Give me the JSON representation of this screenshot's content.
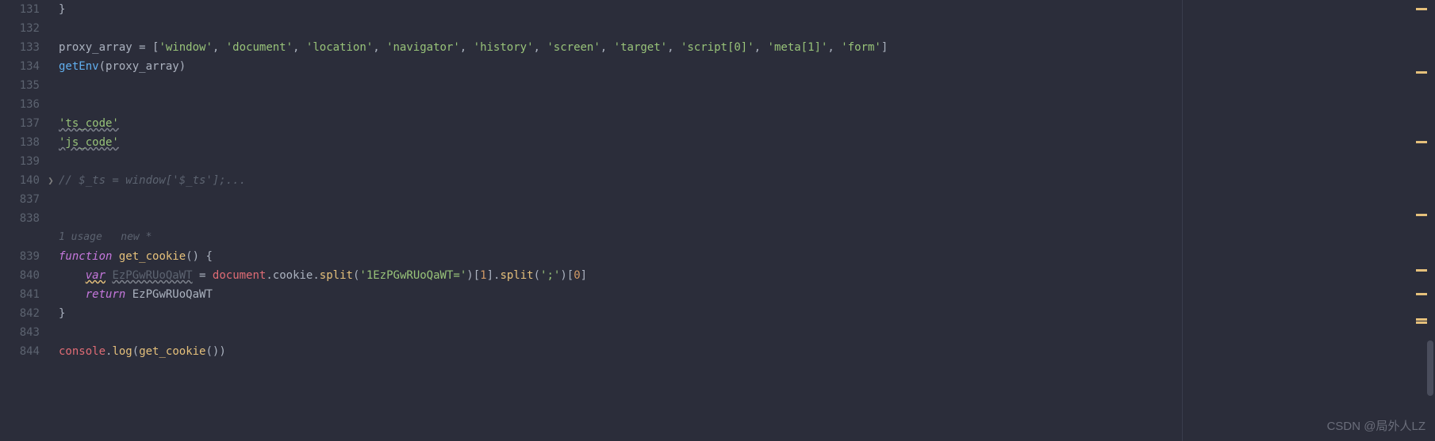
{
  "gutter": {
    "lines": [
      "131",
      "132",
      "133",
      "134",
      "135",
      "136",
      "137",
      "138",
      "139",
      "140",
      "837",
      "838",
      "",
      "839",
      "840",
      "841",
      "842",
      "843",
      "844"
    ]
  },
  "fold": {
    "marker_index": 9,
    "marker_glyph": "❯"
  },
  "code": {
    "l131": "}",
    "l133_var": "proxy_array",
    "l133_eq": " = ",
    "l133_open": "[",
    "l133_s1": "'window'",
    "l133_s2": "'document'",
    "l133_s3": "'location'",
    "l133_s4": "'navigator'",
    "l133_s5": "'history'",
    "l133_s6": "'screen'",
    "l133_s7": "'target'",
    "l133_s8": "'script[0]'",
    "l133_s9": "'meta[1]'",
    "l133_s10": "'form'",
    "l133_comma": ", ",
    "l133_close": "]",
    "l134_fn": "getEnv",
    "l134_open": "(",
    "l134_arg": "proxy_array",
    "l134_close": ")",
    "l137": "'ts_code'",
    "l138": "'js_code'",
    "l140": "// $_ts = window['$_ts'];...",
    "inlay": "1 usage   new *",
    "l839_kw": "function",
    "l839_sp": " ",
    "l839_name": "get_cookie",
    "l839_tail": "() {",
    "l840_indent": "    ",
    "l840_var": "var",
    "l840_sp": " ",
    "l840_id": "EzPGwRUoQaWT",
    "l840_eq": " = ",
    "l840_doc": "document",
    "l840_dot": ".",
    "l840_cookie": "cookie",
    "l840_split1": "split",
    "l840_arg1": "'1EzPGwRUoQaWT='",
    "l840_idx1": "1",
    "l840_split2": "split",
    "l840_arg2": "';'",
    "l840_idx2": "0",
    "l840_op": "(",
    "l840_cp": ")",
    "l840_ob": "[",
    "l840_cb": "]",
    "l841_indent": "    ",
    "l841_ret": "return",
    "l841_sp": " ",
    "l841_id": "EzPGwRUoQaWT",
    "l842": "}",
    "l844_console": "console",
    "l844_dot": ".",
    "l844_log": "log",
    "l844_open": "(",
    "l844_call": "get_cookie",
    "l844_inner": "()",
    "l844_close": ")"
  },
  "minimap_marks": [
    10,
    90,
    178,
    270,
    340,
    370,
    402
  ],
  "watermark": "CSDN @局外人LZ"
}
